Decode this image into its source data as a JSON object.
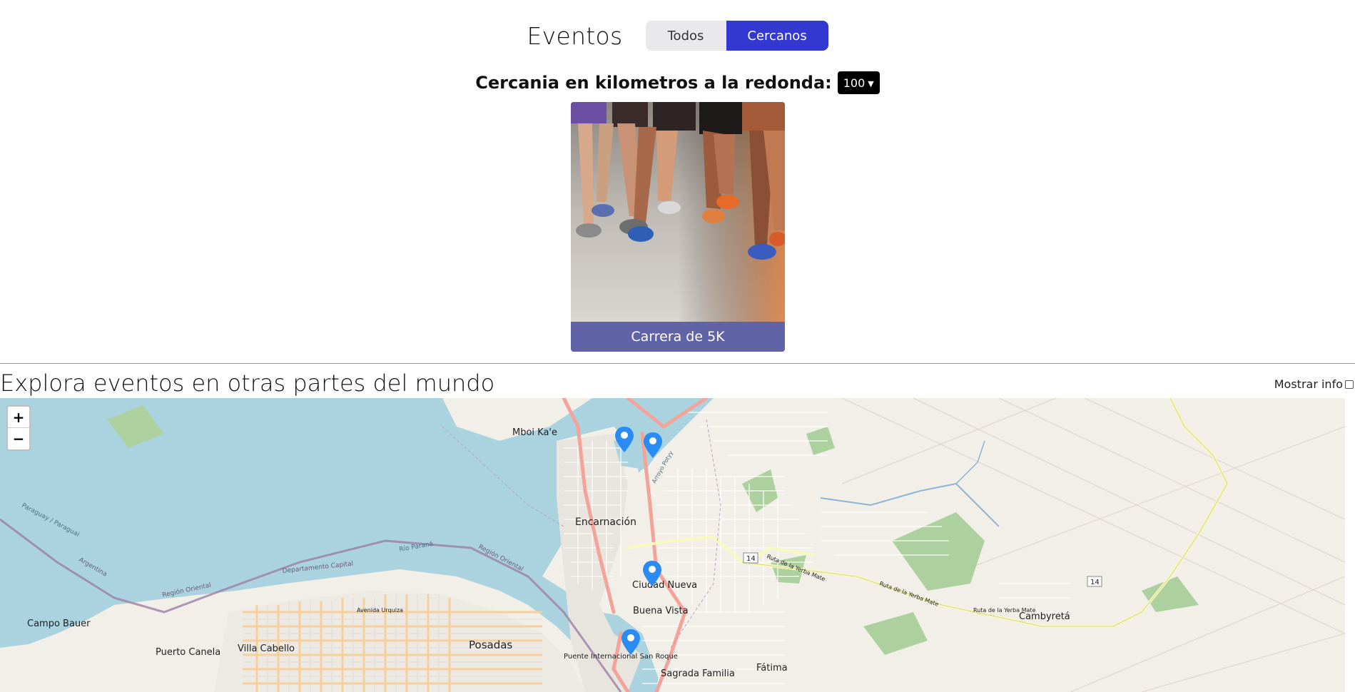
{
  "header": {
    "title": "Eventos",
    "tabs": [
      {
        "label": "Todos",
        "active": false
      },
      {
        "label": "Cercanos",
        "active": true
      }
    ],
    "accent_color": "#3338d1"
  },
  "distance_filter": {
    "label": "Cercania en kilometros a la redonda:",
    "selected_value": "100"
  },
  "events": [
    {
      "title": "Carrera de 5K",
      "image": "running-legs-photo"
    }
  ],
  "explore": {
    "title": "Explora eventos en otras partes del mundo",
    "show_info_label": "Mostrar info",
    "show_info_checked": false
  },
  "map": {
    "zoom_in": "+",
    "zoom_out": "−",
    "place_labels": [
      "Mboi Ka'e",
      "Encarnación",
      "Ciudad Nueva",
      "Buena Vista",
      "Sagrada Familia",
      "Fátima",
      "Posadas",
      "Villa Cabello",
      "Campo Bauer",
      "Puerto Canela",
      "Cambyretá",
      "Puente Internacional San Roque"
    ],
    "road_labels": [
      "14",
      "14",
      "Ruta de la Yerba Mate",
      "Ruta de la Yerba Mate",
      "Ruta de la Yerba Mate",
      "Avenida Urquiza",
      "Región Oriental",
      "Departamento Capital"
    ],
    "river_labels": [
      "Paraguay / Paraguai",
      "Argentina",
      "Región Oriental",
      "Río Paraná",
      "Arroyo Potyy"
    ],
    "marker_count": 4,
    "marker_color": "#2a8bf2"
  }
}
